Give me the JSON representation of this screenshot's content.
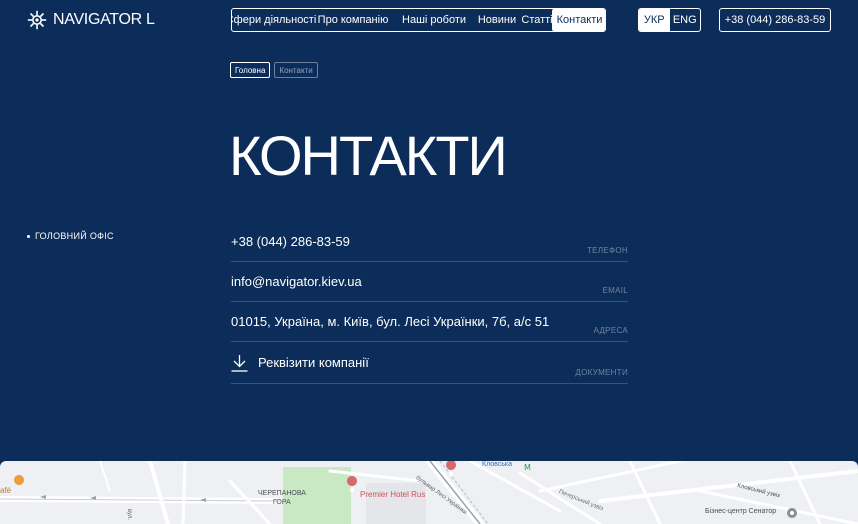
{
  "header": {
    "logo_text": "NAVIGATOR L",
    "nav": [
      {
        "label": "Сфери діяльності",
        "active": false
      },
      {
        "label": "Про компанію",
        "active": false
      },
      {
        "label": "Наші роботи",
        "active": false
      },
      {
        "label": "Новини",
        "active": false
      },
      {
        "label": "Статті",
        "active": false
      },
      {
        "label": "Контакти",
        "active": true
      }
    ],
    "languages": [
      {
        "label": "УКР",
        "active": true
      },
      {
        "label": "ENG",
        "active": false
      }
    ],
    "phone": "+38 (044) 286-83-59"
  },
  "breadcrumb": {
    "home": "Головна",
    "current": "Контакти"
  },
  "page_title": "КОНТАКТИ",
  "sidebar": {
    "office_label": "ГОЛОВНИЙ ОФІС"
  },
  "contacts": {
    "phone": {
      "value": "+38 (044) 286-83-59",
      "label": "ТЕЛЕФОН"
    },
    "email": {
      "value": "info@navigator.kiev.ua",
      "label": "EMAIL"
    },
    "address": {
      "value": "01015, Україна, м. Київ, бул. Лесі Українки, 7б, а/с 51",
      "label": "АДРЕСА"
    },
    "documents": {
      "value": "Реквізити компанії",
      "label": "ДОКУМЕНТИ"
    }
  },
  "map": {
    "labels": {
      "cafe": "afé",
      "district_1": "ЧЕРЕПАНОВА",
      "district_2": "ГОРА",
      "hotel": "Premier Hotel Rus",
      "metro": "Кловська",
      "boulevard": "бульвар Лесі Українки",
      "uzviz": "Кловський узвіз",
      "pechersky": "Печерський узвіз",
      "business": "Бізнес-центр Сенатор",
      "street_short": "вул."
    }
  },
  "colors": {
    "background": "#0c2d5a",
    "text": "#ffffff",
    "map_bg": "#eef0f3",
    "map_poi": "#d9686d",
    "map_park": "#c9e8c4"
  }
}
